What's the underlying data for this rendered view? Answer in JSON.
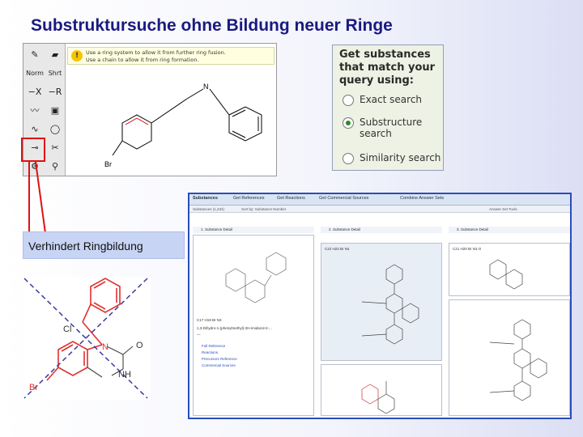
{
  "title": "Substruktursuche ohne Bildung neuer Ringe",
  "editor": {
    "tools": [
      {
        "name": "pencil-icon",
        "glyph": "✎"
      },
      {
        "name": "eraser-icon",
        "glyph": "▰"
      },
      {
        "name": "normal-mode",
        "label": "Norm"
      },
      {
        "name": "shortcut-mode",
        "label": "Shrt"
      },
      {
        "name": "wedge-x-icon",
        "glyph": "−X"
      },
      {
        "name": "wedge-r-icon",
        "glyph": "−R"
      },
      {
        "name": "bond-icon",
        "glyph": "〰"
      },
      {
        "name": "select-icon",
        "glyph": "▣"
      },
      {
        "name": "chain-icon",
        "glyph": "∿"
      },
      {
        "name": "lasso-icon",
        "glyph": "◯"
      },
      {
        "name": "ring-lock-icon",
        "glyph": "⊸"
      },
      {
        "name": "scissors-icon",
        "glyph": "✂"
      },
      {
        "name": "gear-icon",
        "glyph": "⚙"
      },
      {
        "name": "fusion-icon",
        "glyph": "⚲"
      }
    ],
    "hint_line_1": "Use a ring system to allow it from further ring fusion.",
    "hint_line_2": "Use a chain to allow it from ring formation.",
    "hint_icon": "!",
    "atom_n": "N",
    "atom_br": "Br"
  },
  "callout": "Verhindert Ringbildung",
  "options": {
    "heading": "Get substances that match your query using:",
    "items": [
      {
        "label": "Exact search",
        "checked": false
      },
      {
        "label": "Substructure search",
        "checked": true
      },
      {
        "label": "Similarity search",
        "checked": false
      }
    ]
  },
  "results": {
    "tabs": [
      "Substances",
      "Get References",
      "Get Reactions",
      "Get Commercial Sources",
      "Combine Answer Sets"
    ],
    "toolbar_left": "Substances (1,234)",
    "toolbar_mid": "Sort by: Substance Number",
    "toolbar_right": "Answer Set Tools",
    "columns": [
      {
        "header": "1. Substance Detail",
        "reg": "~",
        "formula": "C17 H18 Br N3",
        "text_lines": [
          "1,3-Dihydro-1-(phenylmethyl)-2H-imidazol-2-...",
          "—",
          "Full Reference",
          "Reactions",
          "Precursors Reference",
          "Commercial Sources"
        ]
      },
      {
        "header": "2. Substance Detail",
        "reg": "—",
        "formula": "C22 H23 Br N4"
      },
      {
        "header": "3. Substance Detail",
        "reg": "—",
        "formula": "C21 H20 Br N3 O"
      }
    ]
  },
  "molecule": {
    "label_cl": "Cl",
    "label_n": "N",
    "label_nh": "NH",
    "label_o": "O",
    "label_br": "Br"
  },
  "colors": {
    "title": "#1a1a80",
    "arrow": "#e01010",
    "callout_bg": "#c8d4f4",
    "results_border": "#2a4dba",
    "highlight_ring": "#e03030",
    "cross_lines": "#3a3aa0"
  }
}
